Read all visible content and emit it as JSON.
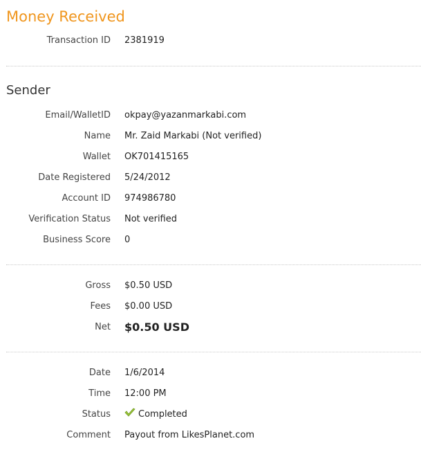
{
  "header": {
    "title": "Money Received"
  },
  "transaction": {
    "id_label": "Transaction ID",
    "id_value": "2381919"
  },
  "sender": {
    "section_title": "Sender",
    "fields": [
      {
        "label": "Email/WalletID",
        "value": "okpay@yazanmarkabi.com"
      },
      {
        "label": "Name",
        "value": "Mr. Zaid Markabi (Not verified)"
      },
      {
        "label": "Wallet",
        "value": "OK701415165"
      },
      {
        "label": "Date Registered",
        "value": "5/24/2012"
      },
      {
        "label": "Account ID",
        "value": "974986780"
      },
      {
        "label": "Verification Status",
        "value": "Not verified"
      },
      {
        "label": "Business Score",
        "value": "0"
      }
    ]
  },
  "amounts": {
    "gross_label": "Gross",
    "gross_value": "$0.50 USD",
    "fees_label": "Fees",
    "fees_value": "$0.00 USD",
    "net_label": "Net",
    "net_value": "$0.50 USD"
  },
  "details": {
    "date_label": "Date",
    "date_value": "1/6/2014",
    "time_label": "Time",
    "time_value": "12:00 PM",
    "status_label": "Status",
    "status_value": "Completed",
    "status_icon": "check-icon",
    "comment_label": "Comment",
    "comment_value": "Payout from LikesPlanet.com"
  },
  "colors": {
    "title": "#f0961e",
    "check": "#9cc63b"
  }
}
